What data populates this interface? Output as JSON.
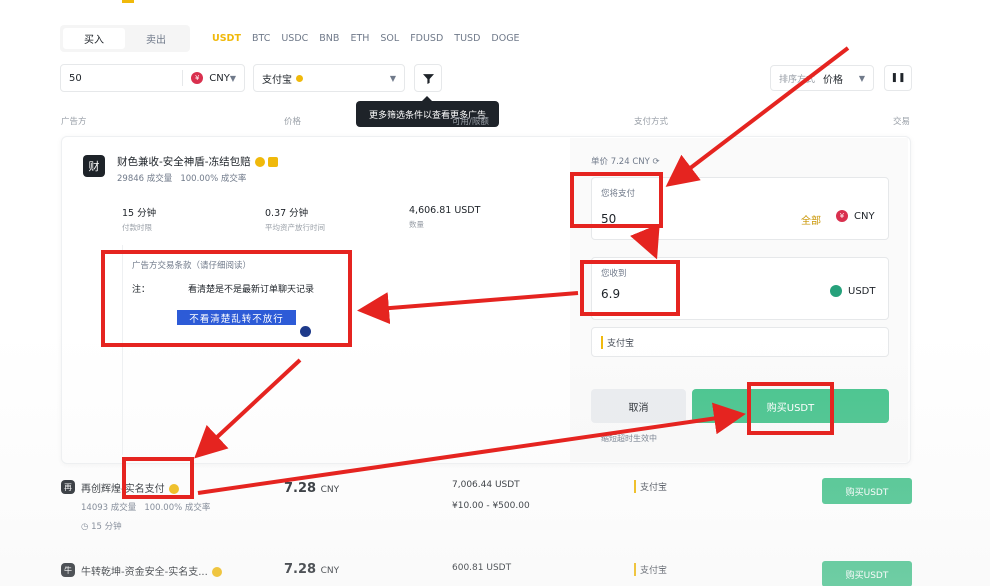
{
  "trade_tabs": [
    "买入",
    "卖出"
  ],
  "coins": [
    "USDT",
    "BTC",
    "USDC",
    "BNB",
    "ETH",
    "SOL",
    "FDUSD",
    "TUSD",
    "DOGE"
  ],
  "filters": {
    "amount_value": "50",
    "fiat_symbol": "¥",
    "fiat": "CNY",
    "payment": "支付宝",
    "tooltip": "更多筛选条件以查看更多广告",
    "sort_label": "排序方式",
    "sort_value": "价格"
  },
  "columns": [
    "广告方",
    "价格",
    "可用/限额",
    "支付方式",
    "交易"
  ],
  "expanded_ad": {
    "avatar_char": "财",
    "name": "财色兼收-安全神盾-冻结包赔",
    "orders": "29846 成交量",
    "completion": "100.00% 成交率",
    "stats": [
      {
        "value": "15 分钟",
        "label": "付款时限"
      },
      {
        "value": "0.37 分钟",
        "label": "平均资产放行时间"
      },
      {
        "value": "4,606.81 USDT",
        "label": "数量"
      }
    ],
    "terms_title": "广告方交易条款（请仔细阅读）",
    "terms_note_label": "注：",
    "terms_note": "看清楚是不是最新订单聊天记录",
    "terms_highlight": "不看清楚乱转不放行",
    "unit_price": "单价 7.24 CNY",
    "pay_label": "您将支付",
    "pay_value": "50",
    "all_label": "全部",
    "pay_currency": "CNY",
    "receive_label": "您收到",
    "receive_value": "6.9",
    "receive_currency": "USDT",
    "payment_method": "支付宝",
    "cancel_label": "取消",
    "buy_label": "购买USDT",
    "note_below": "缩短超时生效中"
  },
  "rows": [
    {
      "avatar": "再",
      "name": "再创辉煌-实名支付",
      "orders": "14093 成交量",
      "completion": "100.00% 成交率",
      "time": "15 分钟",
      "price": "7.28",
      "currency": "CNY",
      "available": "7,006.44 USDT",
      "limit": "¥10.00 - ¥500.00",
      "payment": "支付宝",
      "action": "购买USDT"
    },
    {
      "avatar": "牛",
      "name": "牛转乾坤-资金安全-实名支...",
      "orders": "",
      "completion": "",
      "time": "",
      "price": "7.28",
      "currency": "CNY",
      "available": "600.81 USDT",
      "limit": "",
      "payment": "支付宝",
      "action": "购买USDT"
    }
  ],
  "colors": {
    "accent": "#f0b90b",
    "buy_green": "#45c38c",
    "annotation_red": "#e52420"
  }
}
